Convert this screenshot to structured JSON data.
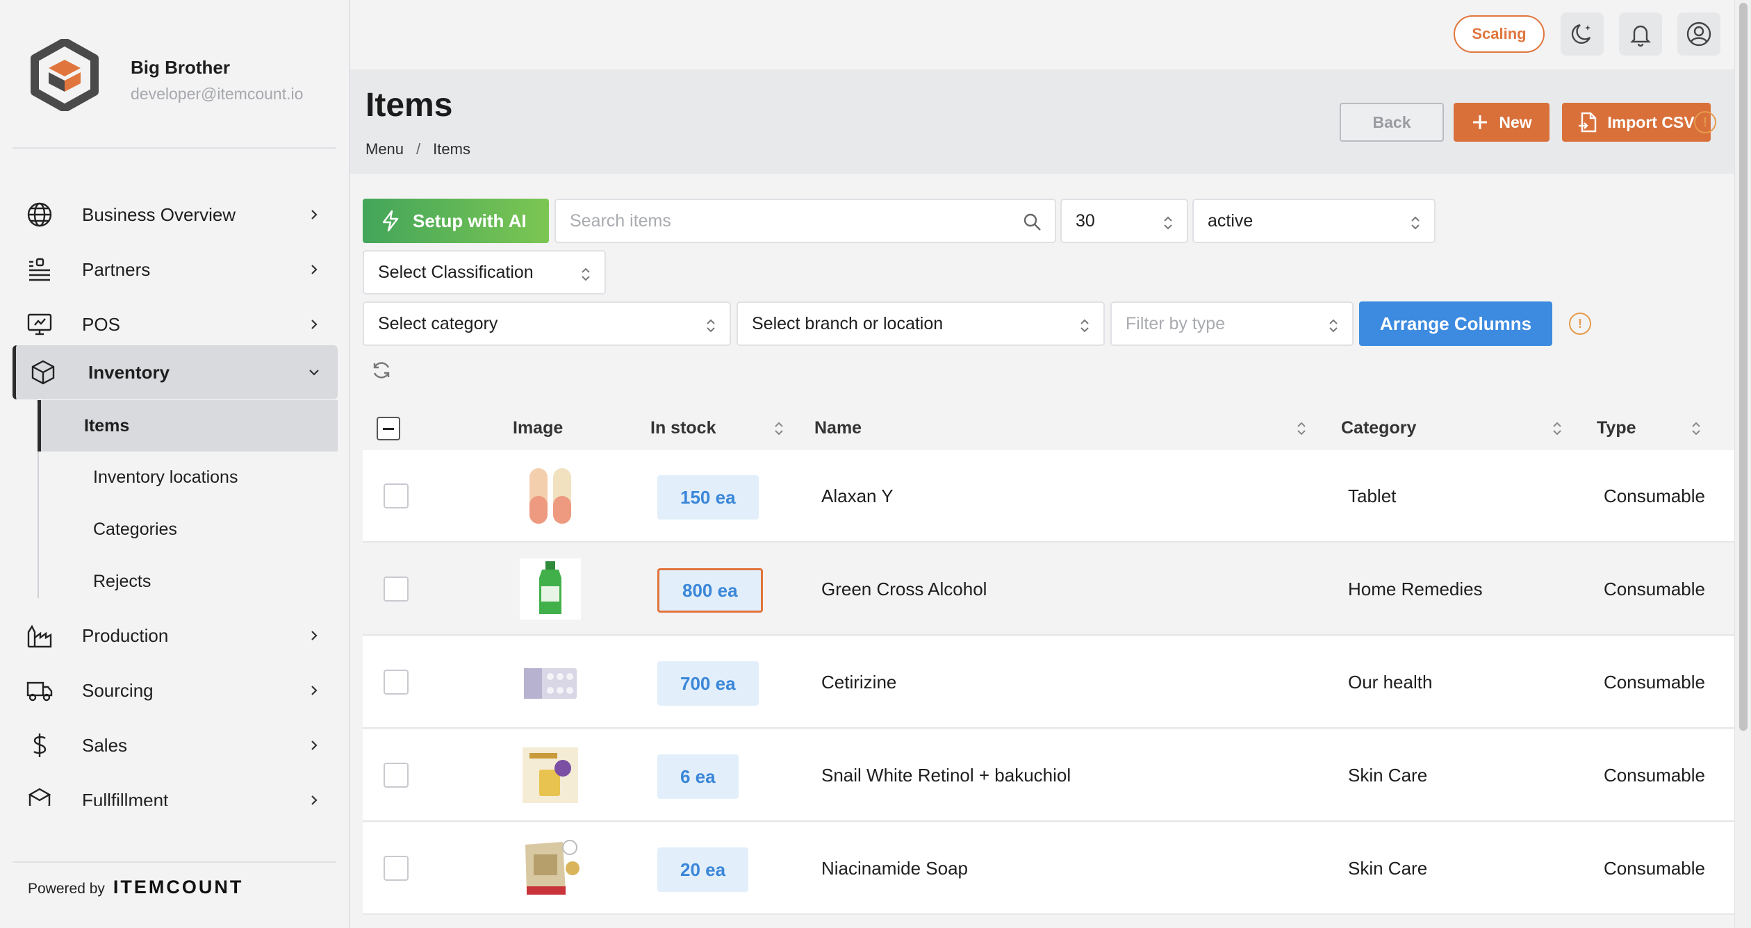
{
  "brand": {
    "name": "Big Brother",
    "email": "developer@itemcount.io"
  },
  "nav": {
    "items": [
      {
        "label": "Business Overview",
        "icon": "globe-icon"
      },
      {
        "label": "Partners",
        "icon": "partners-icon"
      },
      {
        "label": "POS",
        "icon": "pos-icon"
      },
      {
        "label": "Inventory",
        "icon": "box-icon"
      },
      {
        "label": "Production",
        "icon": "factory-icon"
      },
      {
        "label": "Sourcing",
        "icon": "truck-icon"
      },
      {
        "label": "Sales",
        "icon": "dollar-icon"
      },
      {
        "label": "Fullfillment",
        "icon": "fulfillment-icon"
      }
    ],
    "inventory_sub": [
      "Items",
      "Inventory locations",
      "Categories",
      "Rejects"
    ]
  },
  "footer": {
    "powered_by": "Powered by",
    "logo_text": "ITEMCOUNT"
  },
  "topbar": {
    "scaling_label": "Scaling"
  },
  "header": {
    "title": "Items",
    "breadcrumb": [
      "Menu",
      "/",
      "Items"
    ],
    "back_label": "Back",
    "new_label": "New",
    "import_label": "Import CSV",
    "warn_symbol": "!"
  },
  "filters": {
    "ai_label": "Setup with AI",
    "search_placeholder": "Search items",
    "page_size": "30",
    "status": "active",
    "classification": "Select Classification",
    "category": "Select category",
    "branch": "Select branch or location",
    "type_placeholder": "Filter by type",
    "arrange_label": "Arrange Columns"
  },
  "table": {
    "columns": {
      "image": "Image",
      "in_stock": "In stock",
      "name": "Name",
      "category": "Category",
      "type": "Type"
    },
    "rows": [
      {
        "stock": "150 ea",
        "name": "Alaxan Y",
        "category": "Tablet",
        "type": "Consumable",
        "image": "capsule"
      },
      {
        "stock": "800 ea",
        "name": "Green Cross Alcohol",
        "category": "Home Remedies",
        "type": "Consumable",
        "image": "bottle"
      },
      {
        "stock": "700 ea",
        "name": "Cetirizine",
        "category": "Our health",
        "type": "Consumable",
        "image": "blister"
      },
      {
        "stock": "6 ea",
        "name": "Snail White Retinol + bakuchiol",
        "category": "Skin Care",
        "type": "Consumable",
        "image": "cream-box"
      },
      {
        "stock": "20 ea",
        "name": "Niacinamide Soap",
        "category": "Skin Care",
        "type": "Consumable",
        "image": "soap-pack"
      }
    ]
  },
  "colors": {
    "accent_orange": "#d9703a",
    "accent_blue": "#3c8be0",
    "accent_green": "#43a55a",
    "stock_text": "#3a86d8"
  }
}
